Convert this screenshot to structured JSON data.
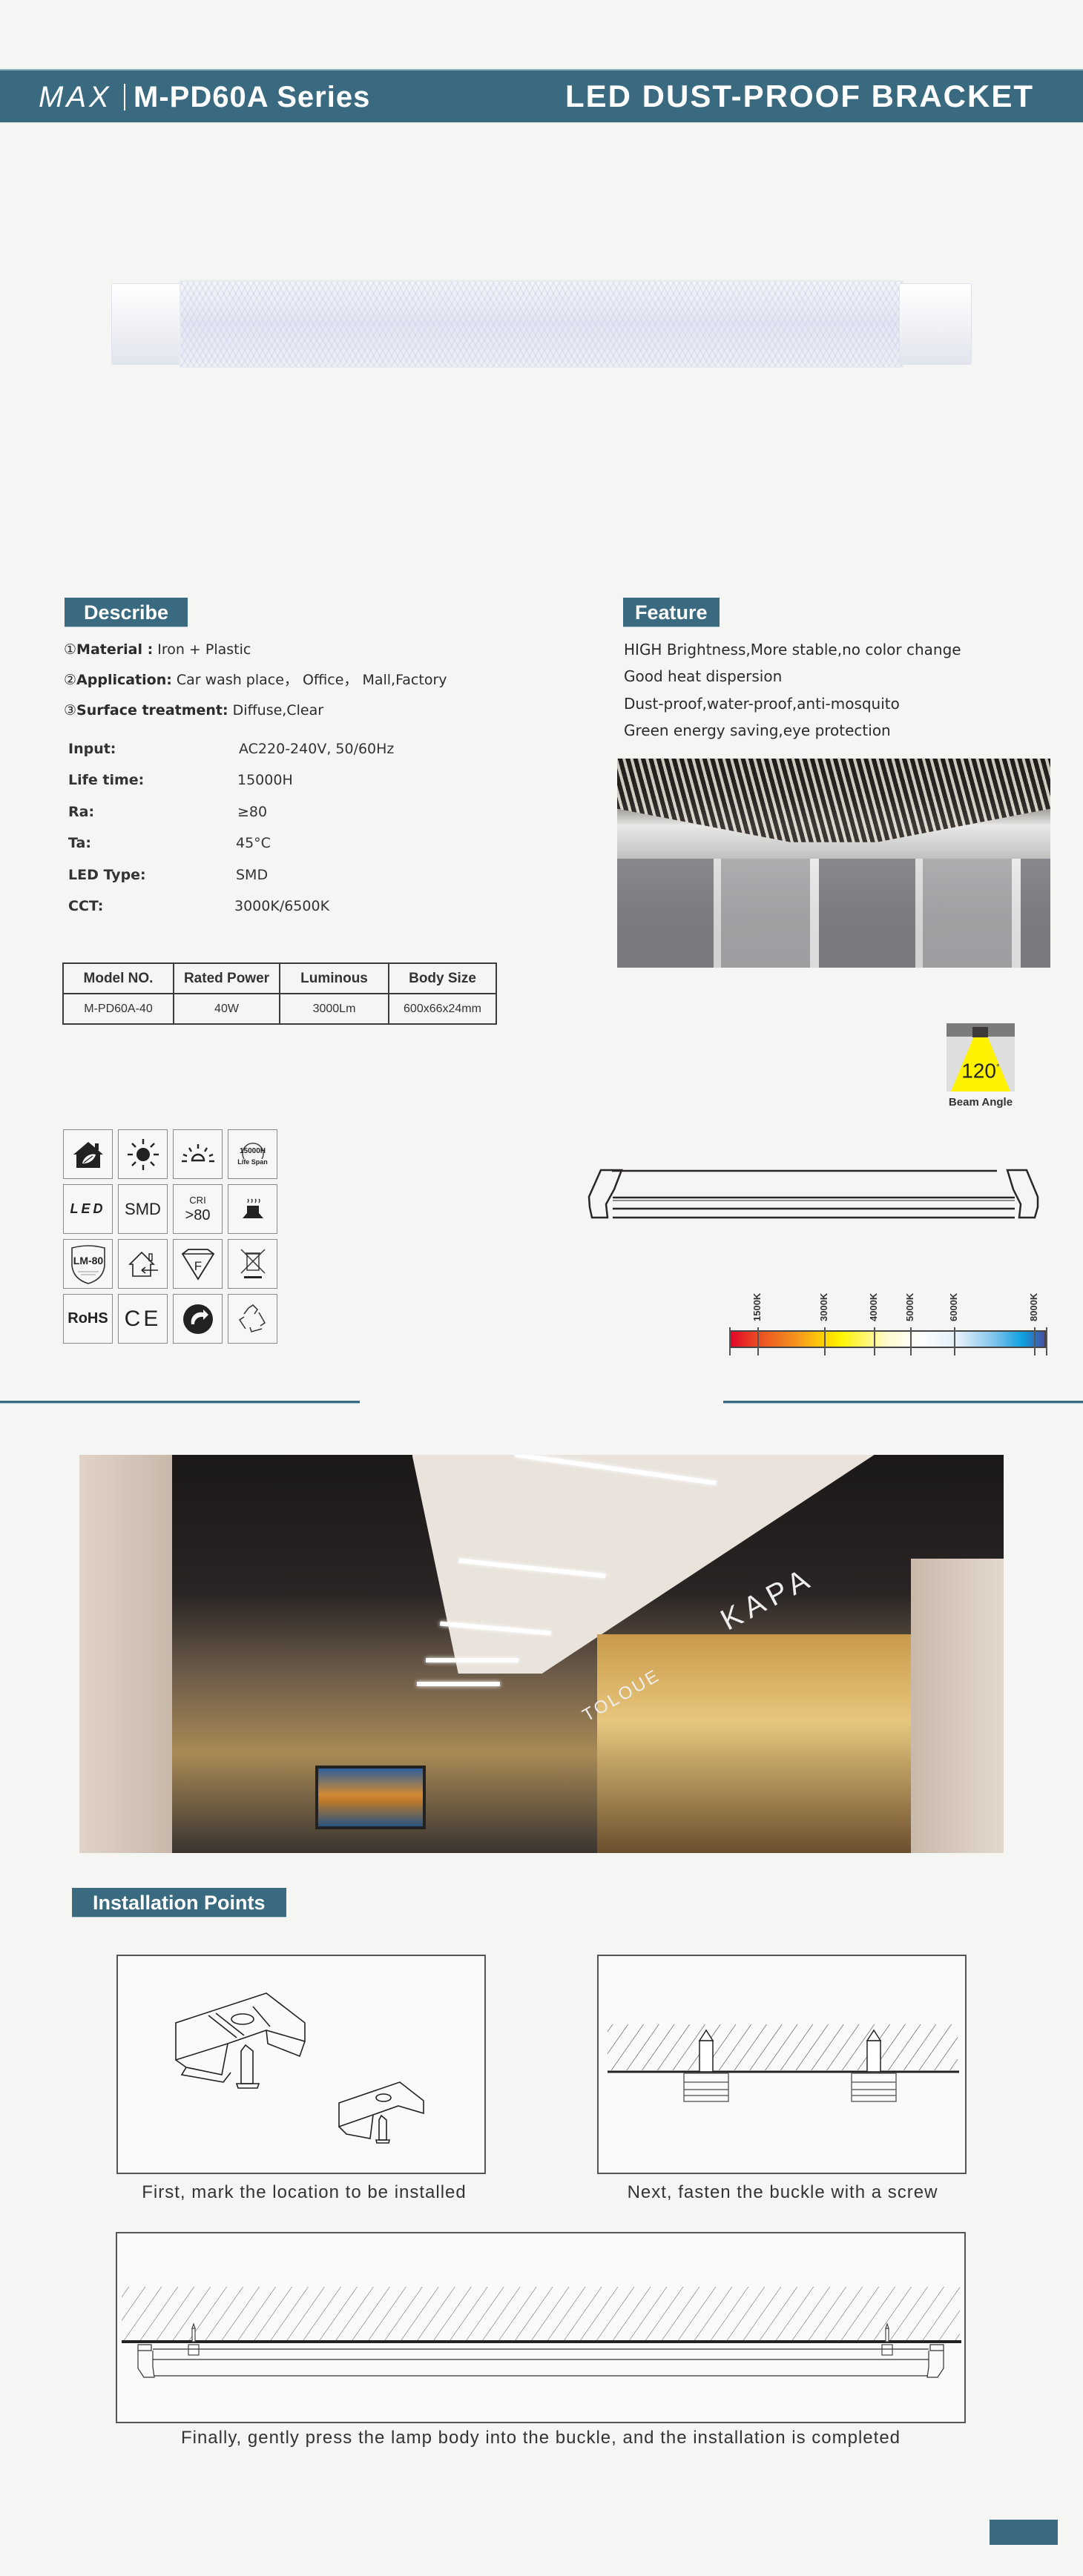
{
  "header": {
    "brand": "MAX",
    "series": "M-PD60A  Series",
    "product_type": "LED DUST-PROOF BRACKET"
  },
  "describe": {
    "title": "Describe",
    "items": [
      {
        "num": "①",
        "label": "Material :",
        "value": " Iron + Plastic"
      },
      {
        "num": "②",
        "label": "Application:",
        "value": " Car wash place， Office， Mall,Factory"
      },
      {
        "num": "③",
        "label": "Surface treatment:",
        "value": " Diffuse,Clear"
      }
    ]
  },
  "specs": [
    {
      "label": "Input:",
      "value": "AC220-240V, 50/60Hz"
    },
    {
      "label": "Life time:",
      "value": "15000H"
    },
    {
      "label": "Ra:",
      "value": "≥80"
    },
    {
      "label": "Ta:",
      "value": "45°C"
    },
    {
      "label": "LED Type:",
      "value": "SMD"
    },
    {
      "label": "CCT:",
      "value": "3000K/6500K"
    }
  ],
  "model_table": {
    "headers": [
      "Model NO.",
      "Rated Power",
      "Luminous",
      "Body Size"
    ],
    "rows": [
      [
        "M-PD60A-40",
        "40W",
        "3000Lm",
        "600x66x24mm"
      ]
    ]
  },
  "feature": {
    "title": "Feature",
    "items": [
      "HIGH Brightness,More stable,no color change",
      "Good heat dispersion",
      "Dust-proof,water-proof,anti-mosquito",
      "Green energy saving,eye protection"
    ]
  },
  "beam_angle": {
    "value": "120",
    "degree_symbol": "°",
    "label": "Beam Angle"
  },
  "icons": {
    "life_span_value": "15000H",
    "life_span_label": "Life Span",
    "led_text": "LED",
    "smd_text": "SMD",
    "cri_label": "CRI",
    "cri_value": ">80",
    "lm80_text": "LM-80",
    "f_mark": "F",
    "rohs_text": "RoHS",
    "ce_text": "CE"
  },
  "color_temperature": {
    "ticks": [
      "1500K",
      "3000K",
      "4000K",
      "5000K",
      "6000K",
      "8000K"
    ]
  },
  "mall_signs": [
    "KAPA",
    "TOLOUE"
  ],
  "installation": {
    "title": "Installation Points",
    "steps": [
      "First, mark the location to be installed",
      "Next, fasten the buckle with a screw",
      "Finally, gently press the lamp body into the buckle, and the installation is completed"
    ]
  },
  "colors": {
    "brand": "#3a6a80",
    "background": "#f5f5f3"
  }
}
